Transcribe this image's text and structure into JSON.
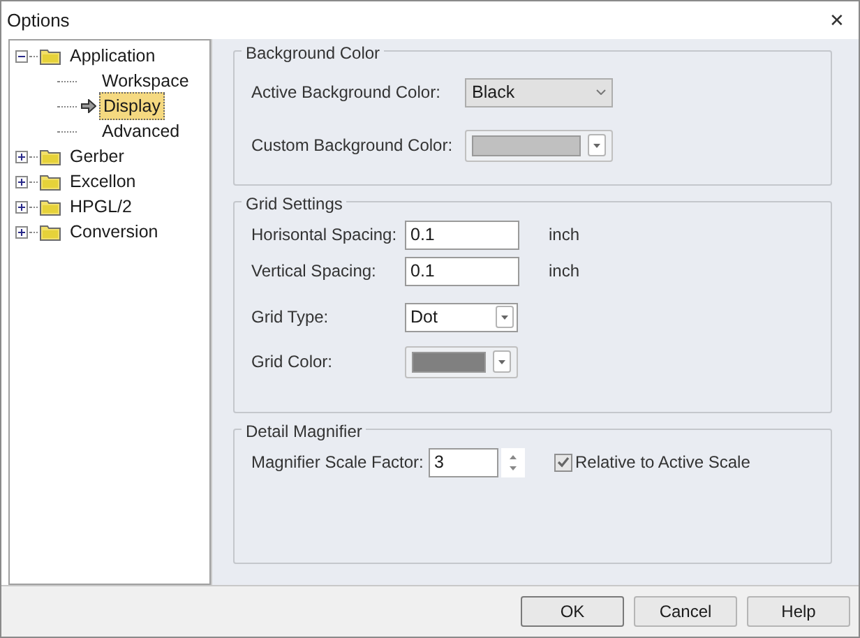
{
  "window": {
    "title": "Options",
    "close": "✕"
  },
  "tree": [
    {
      "label": "Application",
      "expanded": true,
      "selected": false,
      "children": [
        {
          "label": "Workspace",
          "selected": false,
          "current": false
        },
        {
          "label": "Display",
          "selected": true,
          "current": true
        },
        {
          "label": "Advanced",
          "selected": false,
          "current": false
        }
      ]
    },
    {
      "label": "Gerber",
      "expanded": false,
      "selected": false
    },
    {
      "label": "Excellon",
      "expanded": false,
      "selected": false
    },
    {
      "label": "HPGL/2",
      "expanded": false,
      "selected": false
    },
    {
      "label": "Conversion",
      "expanded": false,
      "selected": false
    }
  ],
  "background_color": {
    "title": "Background Color",
    "active_label": "Active Background Color:",
    "active_value": "Black",
    "custom_label": "Custom Background Color:",
    "custom_swatch": {
      "color": "#c0c0c0"
    }
  },
  "grid_settings": {
    "title": "Grid Settings",
    "horizontal_label": "Horisontal Spacing:",
    "horizontal_value": "0.1",
    "horizontal_unit": "inch",
    "vertical_label": "Vertical Spacing:",
    "vertical_value": "0.1",
    "vertical_unit": "inch",
    "type_label": "Grid Type:",
    "type_value": "Dot",
    "color_label": "Grid Color:",
    "color": "#808080"
  },
  "detail_magnifier": {
    "title": "Detail Magnifier",
    "factor_label": "Magnifier Scale Factor:",
    "factor_value": "3",
    "relative_label": "Relative to Active Scale",
    "relative_checked": true
  },
  "buttons": [
    "OK",
    "Cancel",
    "Help"
  ]
}
